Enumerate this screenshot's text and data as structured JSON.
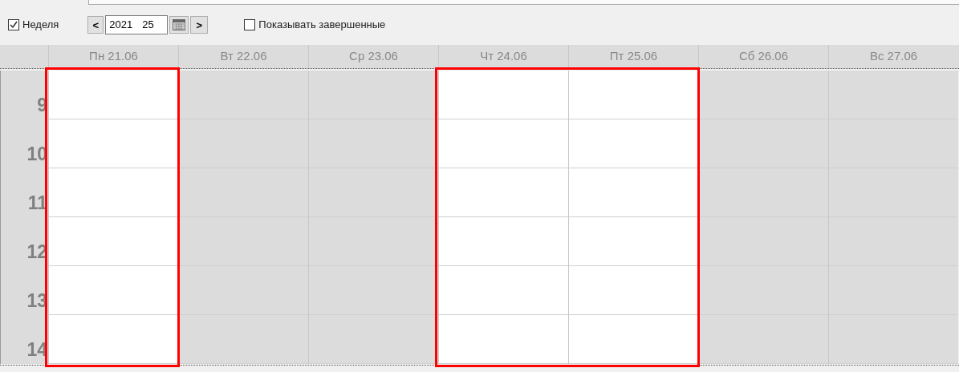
{
  "toolbar": {
    "week_checkbox": {
      "label": "Неделя",
      "checked": true
    },
    "prev_button": "<",
    "year": "2021",
    "week": "25",
    "next_button": ">",
    "completed_checkbox": {
      "label": "Показывать завершенные",
      "checked": false
    }
  },
  "days": [
    {
      "label": "Пн 21.06",
      "working": true,
      "framed": true
    },
    {
      "label": "Вт 22.06",
      "working": false,
      "framed": false
    },
    {
      "label": "Ср 23.06",
      "working": false,
      "framed": false
    },
    {
      "label": "Чт 24.06",
      "working": true,
      "framed": true
    },
    {
      "label": "Пт 25.06",
      "working": true,
      "framed": true
    },
    {
      "label": "Сб 26.06",
      "working": false,
      "framed": false
    },
    {
      "label": "Вс 27.06",
      "working": false,
      "framed": false
    }
  ],
  "hours": [
    "9",
    "10",
    "11",
    "12",
    "13",
    "14"
  ]
}
